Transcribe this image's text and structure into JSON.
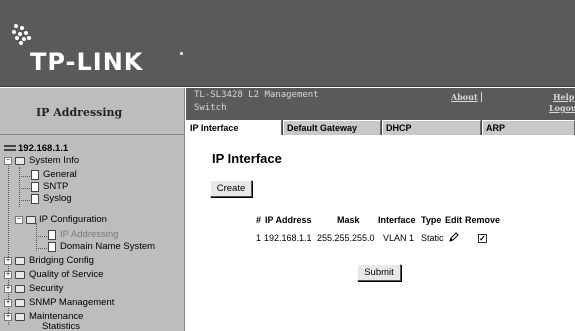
{
  "brand": {
    "logo_text": "TP-LINK"
  },
  "sidebar": {
    "title": "IP Addressing"
  },
  "header": {
    "device_name": "TL-SL3428 L2 Management Switch",
    "about_link": "About",
    "help_link": "Help",
    "logout_link": "Logout"
  },
  "tabs": [
    {
      "label": "IP Interface",
      "active": true
    },
    {
      "label": "Default Gateway",
      "active": false
    },
    {
      "label": "DHCP",
      "active": false
    },
    {
      "label": "ARP",
      "active": false
    }
  ],
  "nav": {
    "root": "192.168.1.1",
    "items": [
      {
        "label": "System Info",
        "icon": "folder-open-icon"
      },
      {
        "label": "General",
        "icon": "page-icon"
      },
      {
        "label": "SNTP",
        "icon": "page-icon"
      },
      {
        "label": "Syslog",
        "icon": "page-icon"
      },
      {
        "label": "IP Configuration",
        "icon": "folder-open-icon"
      },
      {
        "label": "IP Addressing",
        "icon": "page-icon",
        "disabled": true
      },
      {
        "label": "Domain Name System",
        "icon": "page-icon"
      },
      {
        "label": "Bridging Config",
        "icon": "folder-closed-icon"
      },
      {
        "label": "Quality of Service",
        "icon": "folder-closed-icon"
      },
      {
        "label": "Security",
        "icon": "folder-closed-icon"
      },
      {
        "label": "SNMP Management",
        "icon": "folder-closed-icon"
      },
      {
        "label": "Maintenance",
        "icon": "folder-closed-icon"
      },
      {
        "label": "Statistics",
        "icon": "folder-closed-icon"
      }
    ]
  },
  "main": {
    "title": "IP Interface",
    "create_button": "Create",
    "submit_button": "Submit",
    "table": {
      "headers": [
        "#",
        "IP Address",
        "Mask",
        "Interface",
        "Type",
        "Edit",
        "Remove"
      ],
      "rows": [
        {
          "index": "1",
          "ip": "192.168.1.1",
          "mask": "255.255.255.0",
          "interface": "VLAN 1",
          "type": "Static",
          "edit_icon": "pencil-icon",
          "remove_checked": true
        }
      ]
    }
  }
}
